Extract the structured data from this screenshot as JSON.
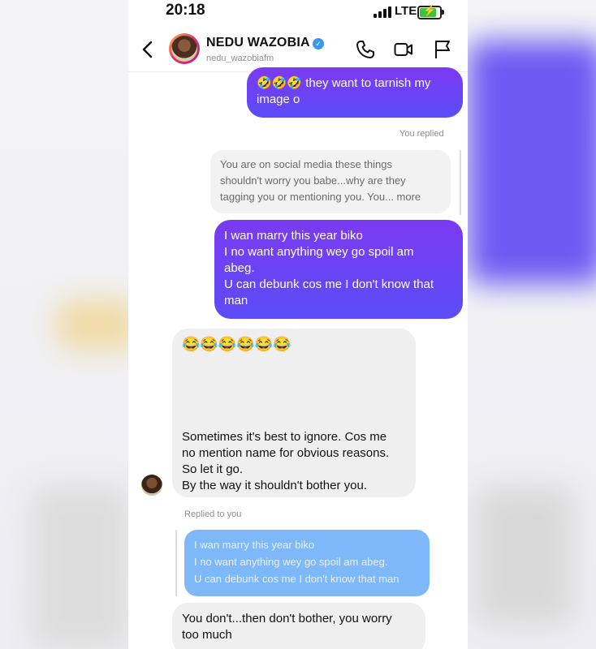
{
  "status_bar": {
    "time": "20:18",
    "network": "LTE"
  },
  "header": {
    "name": "NEDU WAZOBIA",
    "handle": "nedu_wazobiafm"
  },
  "messages": {
    "m1": {
      "emoji": "🤣🤣🤣",
      "text": "they want to tarnish my",
      "text2": "image o"
    },
    "you_replied": "You replied",
    "quote1": {
      "lines": [
        "You are on social media these things",
        "shouldn't worry you babe...why are they",
        "tagging you or mentioning you. You... more"
      ]
    },
    "m2": {
      "lines": [
        "I wan marry this year biko",
        "I no want anything wey go spoil am",
        "abeg.",
        "U can debunk cos me I don't know that",
        "man"
      ]
    },
    "m3": {
      "emoji": "😂😂😂😂😂😂",
      "lines": [
        "Sometimes it's best to ignore. Cos me",
        "no mention name for obvious reasons.",
        "So let it go.",
        "By the way it shouldn't bother you."
      ]
    },
    "replied_to_you": "Replied to you",
    "quote2": {
      "lines": [
        "I wan marry this year biko",
        "I no want anything wey go spoil am abeg.",
        "U can debunk cos me I don't know that man"
      ]
    },
    "m4": {
      "lines": [
        "You don't...then don't bother, you worry",
        "too much"
      ]
    }
  },
  "colors": {
    "sent_bubble_top": "#7b3af2",
    "sent_bubble_bottom": "#5b4cf6",
    "received_bubble": "#efefef",
    "quoted_blue": "#7fb8f8",
    "verified": "#3897f0"
  },
  "icons": [
    "back-chevron-icon",
    "verified-badge-icon",
    "phone-call-icon",
    "video-call-icon",
    "flag-icon",
    "signal-bars-icon",
    "battery-charging-icon"
  ]
}
